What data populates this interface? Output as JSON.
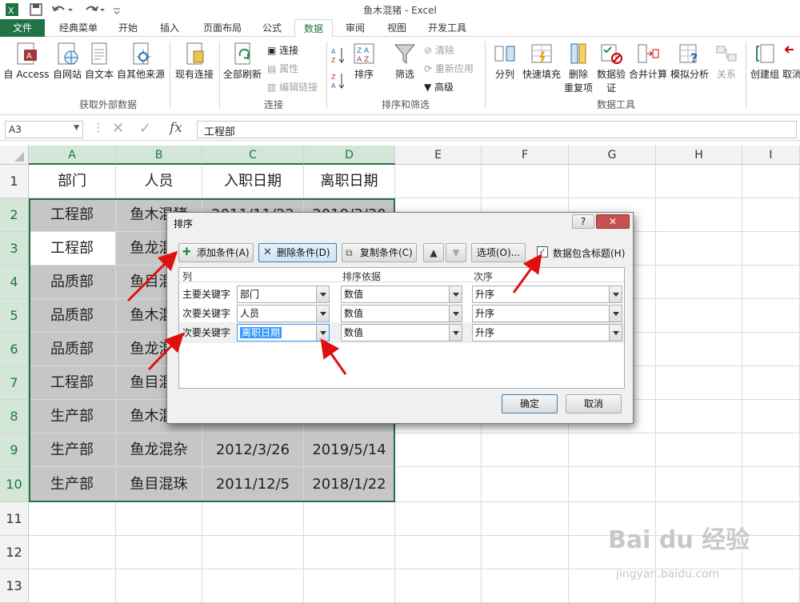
{
  "window": {
    "title": "鱼木混猪 - Excel"
  },
  "tabs": [
    "文件",
    "经典菜单",
    "开始",
    "插入",
    "页面布局",
    "公式",
    "数据",
    "审阅",
    "视图",
    "开发工具"
  ],
  "ribbon": {
    "get_external": {
      "access": "自 Access",
      "web": "自网站",
      "text": "自文本",
      "other": "自其他来源",
      "existing": "现有连接",
      "group": "获取外部数据"
    },
    "connections": {
      "refresh_all": "全部刷新",
      "connections": "连接",
      "properties": "属性",
      "edit_links": "编辑链接",
      "group": "连接"
    },
    "sort_filter": {
      "sort": "排序",
      "filter": "筛选",
      "clear": "清除",
      "reapply": "重新应用",
      "advanced": "高级",
      "group": "排序和筛选"
    },
    "data_tools": {
      "text_to_columns": "分列",
      "flash_fill": "快速填充",
      "remove_dup_1": "删除",
      "remove_dup_2": "重复项",
      "validation_1": "数据验",
      "validation_2": "证",
      "consolidate": "合并计算",
      "what_if": "模拟分析",
      "relationships": "关系",
      "group": "数据工具"
    },
    "outline": {
      "group_btn": "创建组",
      "ungroup": "取消"
    }
  },
  "formula_bar": {
    "name_box": "A3",
    "formula": "工程部"
  },
  "columns": [
    "A",
    "B",
    "C",
    "D",
    "E",
    "F",
    "G",
    "H",
    "I"
  ],
  "rows": [
    "1",
    "2",
    "3",
    "4",
    "5",
    "6",
    "7",
    "8",
    "9",
    "10",
    "11",
    "12",
    "13"
  ],
  "cells": {
    "r1": [
      "部门",
      "人员",
      "入职日期",
      "离职日期"
    ],
    "r2": [
      "工程部",
      "鱼木混猪",
      "2011/11/22",
      "2019/3/30"
    ],
    "r3": [
      "工程部",
      "鱼龙混杂",
      "",
      ""
    ],
    "r4": [
      "品质部",
      "鱼目混珠",
      "",
      ""
    ],
    "r5": [
      "品质部",
      "鱼木混猪",
      "",
      ""
    ],
    "r6": [
      "品质部",
      "鱼龙混杂",
      "",
      ""
    ],
    "r7": [
      "工程部",
      "鱼目混珠",
      "",
      ""
    ],
    "r8": [
      "生产部",
      "鱼木混猪",
      "",
      ""
    ],
    "r9": [
      "生产部",
      "鱼龙混杂",
      "2012/3/26",
      "2019/5/14"
    ],
    "r10": [
      "生产部",
      "鱼目混珠",
      "2011/12/5",
      "2018/1/22"
    ]
  },
  "dialog": {
    "title": "排序",
    "help": "?",
    "close": "✕",
    "add_level": "添加条件(A)",
    "delete_level": "删除条件(D)",
    "copy_level": "复制条件(C)",
    "options": "选项(O)...",
    "has_headers": "数据包含标题(H)",
    "has_headers_checked": true,
    "col_header_column": "列",
    "col_header_sort_on": "排序依据",
    "col_header_order": "次序",
    "levels": [
      {
        "label": "主要关键字",
        "column": "部门",
        "sort_on": "数值",
        "order": "升序"
      },
      {
        "label": "次要关键字",
        "column": "人员",
        "sort_on": "数值",
        "order": "升序"
      },
      {
        "label": "次要关键字",
        "column": "离职日期",
        "sort_on": "数值",
        "order": "升序"
      }
    ],
    "ok": "确定",
    "cancel": "取消"
  },
  "watermark": {
    "brand": "Bai du 经验",
    "url": "jingyan.baidu.com"
  },
  "colors": {
    "excel_green": "#217346",
    "arrow_red": "#e01010",
    "selection_gray": "#c6c6c6"
  }
}
